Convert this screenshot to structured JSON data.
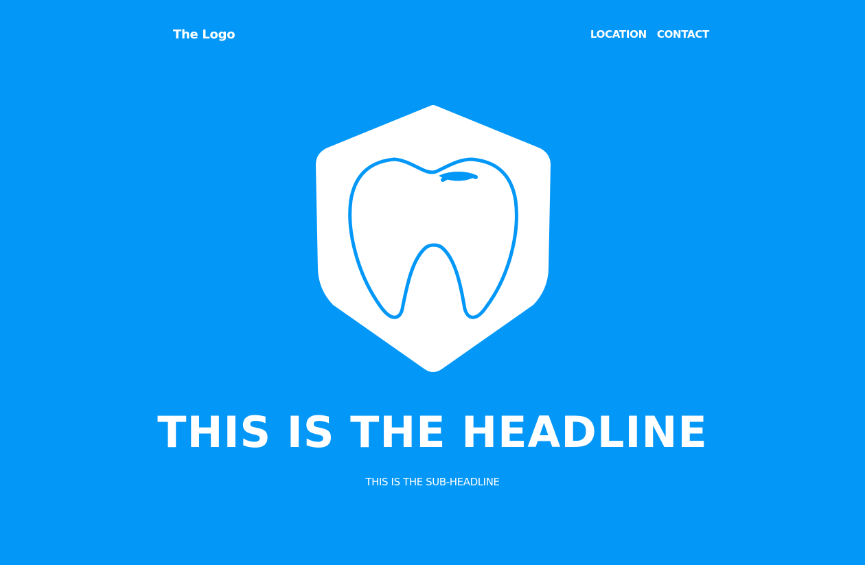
{
  "colors": {
    "background": "#0397f7",
    "foreground": "#ffffff",
    "emblem_accent": "#0397f7"
  },
  "header": {
    "logo_text": "The Logo",
    "nav": [
      {
        "label": "LOCATION"
      },
      {
        "label": "CONTACT"
      }
    ]
  },
  "hero": {
    "emblem_icon": "tooth-shield-icon",
    "headline": "THIS IS THE HEADLINE",
    "subheadline": "THIS IS THE SUB-HEADLINE"
  }
}
